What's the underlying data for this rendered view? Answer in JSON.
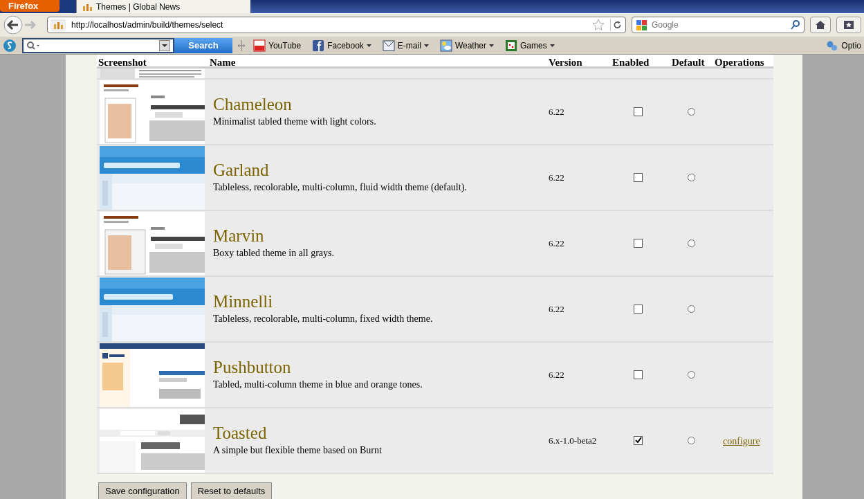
{
  "browser": {
    "app_button": "Firefox",
    "tab_title": "Themes | Global News",
    "url": "http://localhost/admin/build/themes/select",
    "search_placeholder": "Google"
  },
  "toolbar": {
    "search_button": "Search",
    "bookmarks": [
      {
        "label": "YouTube",
        "dropdown": false
      },
      {
        "label": "Facebook",
        "dropdown": true
      },
      {
        "label": "E-mail",
        "dropdown": true
      },
      {
        "label": "Weather",
        "dropdown": true
      },
      {
        "label": "Games",
        "dropdown": true
      }
    ],
    "options": "Optio"
  },
  "table": {
    "columns": [
      "Screenshot",
      "Name",
      "Version",
      "Enabled",
      "Default",
      "Operations"
    ],
    "rows": [
      {
        "name": "Chameleon",
        "description": "Minimalist tabled theme with light colors.",
        "version": "6.22",
        "enabled": false,
        "selected": false
      },
      {
        "name": "Garland",
        "description": "Tableless, recolorable, multi-column, fluid width theme (default).",
        "version": "6.22",
        "enabled": false,
        "selected": false
      },
      {
        "name": "Marvin",
        "description": "Boxy tabled theme in all grays.",
        "version": "6.22",
        "enabled": false,
        "selected": false
      },
      {
        "name": "Minnelli",
        "description": "Tableless, recolorable, multi-column, fixed width theme.",
        "version": "6.22",
        "enabled": false,
        "selected": false
      },
      {
        "name": "Pushbutton",
        "description": "Tabled, multi-column theme in blue and orange tones.",
        "version": "6.22",
        "enabled": false,
        "selected": false
      },
      {
        "name": "Toasted",
        "description": "A simple but flexible theme based on Burnt",
        "version": "6.x-1.0-beta2",
        "enabled": true,
        "selected": false,
        "operation": "configure"
      }
    ]
  },
  "buttons": [
    "Save configuration",
    "Reset to defaults"
  ]
}
